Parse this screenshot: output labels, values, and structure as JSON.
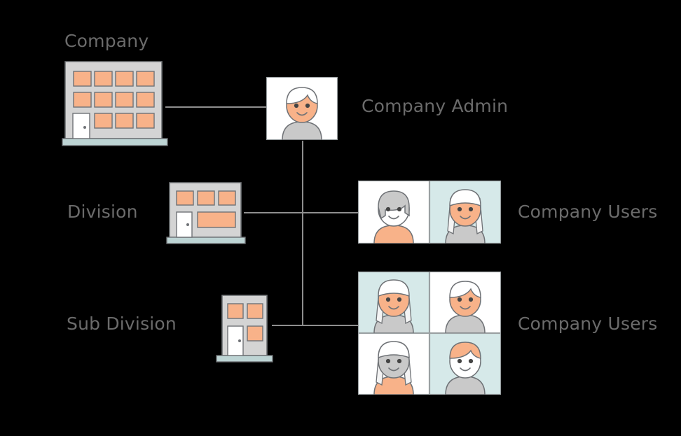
{
  "diagram": {
    "title": "Company hierarchy diagram",
    "background": "#000000",
    "line_color": "#8e8e8e",
    "text_color": "#6b6b6b",
    "palette": {
      "orange": "#f8b289",
      "orange_dark": "#f4a97c",
      "gray_light": "#d4d4d4",
      "gray_mid": "#c9c9c9",
      "white": "#ffffff",
      "blue_tint": "#d6e9e9",
      "base_blue": "#bdd4d4",
      "stroke": "#6f7276"
    }
  },
  "labels": {
    "company": "Company",
    "company_admin": "Company Admin",
    "division": "Division",
    "company_users_1": "Company Users",
    "sub_division": "Sub Division",
    "company_users_2": "Company Users"
  },
  "nodes": {
    "company_building": {
      "name": "Company",
      "icon": "office-building-large-icon",
      "window_rows": [
        4,
        4,
        3
      ],
      "has_door": true,
      "window_count": 11
    },
    "division_building": {
      "name": "Division",
      "icon": "office-building-medium-icon",
      "window_rows": [
        3,
        1
      ],
      "has_door": true,
      "window_count": 4
    },
    "sub_division_building": {
      "name": "Sub Division",
      "icon": "office-building-small-icon",
      "window_rows": [
        2,
        1
      ],
      "has_door": true,
      "window_count": 3
    },
    "company_admin": {
      "name": "Company Admin",
      "icon": "avatar-icon",
      "count": 1,
      "avatars": [
        {
          "hair": "white",
          "face": "orange",
          "body": "gray",
          "bg": "white",
          "hair_length": "short"
        }
      ]
    },
    "company_users_1": {
      "name": "Company Users",
      "icon": "avatar-group-icon",
      "count": 2,
      "avatars": [
        {
          "hair": "gray",
          "face": "white",
          "body": "orange",
          "bg": "white",
          "hair_length": "medium"
        },
        {
          "hair": "white",
          "face": "orange",
          "body": "gray",
          "bg": "blue",
          "hair_length": "long"
        }
      ]
    },
    "company_users_2": {
      "name": "Company Users",
      "icon": "avatar-group-icon",
      "count": 4,
      "avatars": [
        {
          "hair": "white",
          "face": "orange",
          "body": "gray",
          "bg": "blue",
          "hair_length": "long"
        },
        {
          "hair": "white",
          "face": "orange",
          "body": "gray",
          "bg": "white",
          "hair_length": "short"
        },
        {
          "hair": "white",
          "face": "gray",
          "body": "orange",
          "bg": "white",
          "hair_length": "long"
        },
        {
          "hair": "orange",
          "face": "white",
          "body": "gray",
          "bg": "blue",
          "hair_length": "short"
        }
      ]
    }
  },
  "connections": [
    {
      "from": "company_building",
      "to": "company_admin"
    },
    {
      "from": "company_admin",
      "to": "division_building_branch"
    },
    {
      "from": "division_building",
      "to": "company_users_1"
    },
    {
      "from": "sub_division_building",
      "to": "company_users_2"
    }
  ]
}
